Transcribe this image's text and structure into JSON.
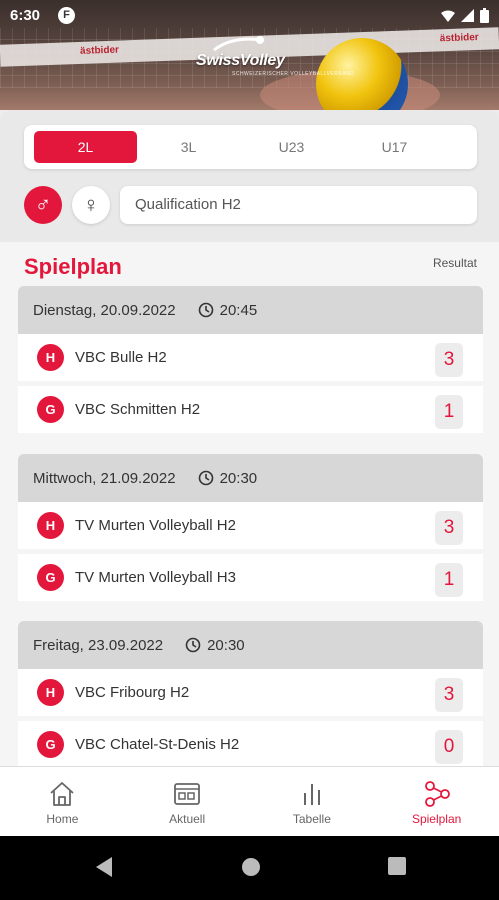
{
  "status_bar": {
    "time": "6:30",
    "app_icon_letter": "F"
  },
  "header": {
    "logo_text": "SwissVolley",
    "logo_subtitle": "SCHWEIZERISCHER VOLLEYBALLVERBAND",
    "banner_texts": [
      "ästbider",
      "ästbider",
      "ästbider"
    ]
  },
  "league_tabs": [
    {
      "label": "2L",
      "active": true
    },
    {
      "label": "3L",
      "active": false
    },
    {
      "label": "U23",
      "active": false
    },
    {
      "label": "U17",
      "active": false
    }
  ],
  "gender": {
    "male_symbol": "♂",
    "female_symbol": "♀",
    "selected": "male"
  },
  "league_select": {
    "value": "Qualification H2"
  },
  "schedule": {
    "title": "Spielplan",
    "result_label": "Resultat",
    "days": [
      {
        "date": "Dienstag, 20.09.2022",
        "time": "20:45",
        "matches": [
          {
            "badge": "H",
            "team": "VBC Bulle H2",
            "score": "3"
          },
          {
            "badge": "G",
            "team": "VBC Schmitten H2",
            "score": "1"
          }
        ]
      },
      {
        "date": "Mittwoch, 21.09.2022",
        "time": "20:30",
        "matches": [
          {
            "badge": "H",
            "team": "TV Murten Volleyball H2",
            "score": "3"
          },
          {
            "badge": "G",
            "team": "TV Murten Volleyball H3",
            "score": "1"
          }
        ]
      },
      {
        "date": "Freitag, 23.09.2022",
        "time": "20:30",
        "matches": [
          {
            "badge": "H",
            "team": "VBC Fribourg H2",
            "score": "3"
          },
          {
            "badge": "G",
            "team": "VBC Chatel-St-Denis H2",
            "score": "0"
          }
        ]
      }
    ]
  },
  "bottom_nav": [
    {
      "label": "Home",
      "icon": "home-icon",
      "active": false
    },
    {
      "label": "Aktuell",
      "icon": "news-icon",
      "active": false
    },
    {
      "label": "Tabelle",
      "icon": "bar-chart-icon",
      "active": false
    },
    {
      "label": "Spielplan",
      "icon": "schedule-nodes-icon",
      "active": true
    }
  ],
  "colors": {
    "accent": "#e3173c",
    "background": "#f5f5f5",
    "day_header": "#d7d7d7"
  }
}
